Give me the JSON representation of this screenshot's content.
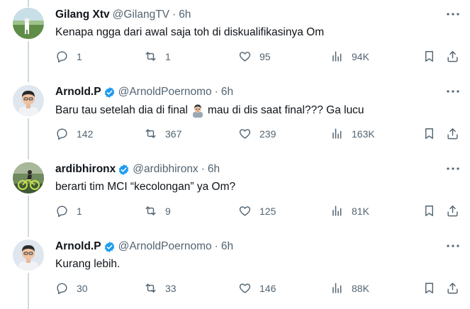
{
  "tweets": [
    {
      "name": "Gilang Xtv",
      "handle": "@GilangTV",
      "time": "6h",
      "verified": false,
      "text": "Kenapa ngga dari awal saja toh di diskualifikasinya Om",
      "text_after": "",
      "emoji": "",
      "replies": "1",
      "retweets": "1",
      "likes": "95",
      "views": "94K"
    },
    {
      "name": "Arnold.P",
      "handle": "@ArnoldPoernomo",
      "time": "6h",
      "verified": true,
      "text": "Baru tau setelah dia di final",
      "text_after": "mau di dis saat final??? Ga lucu",
      "emoji": "man-gesturing-icon",
      "replies": "142",
      "retweets": "367",
      "likes": "239",
      "views": "163K"
    },
    {
      "name": "ardibhironx",
      "handle": "@ardibhironx",
      "time": "6h",
      "verified": true,
      "text": "berarti tim MCI “kecolongan” ya Om?",
      "text_after": "",
      "emoji": "",
      "replies": "1",
      "retweets": "9",
      "likes": "125",
      "views": "81K"
    },
    {
      "name": "Arnold.P",
      "handle": "@ArnoldPoernomo",
      "time": "6h",
      "verified": true,
      "text": "Kurang lebih.",
      "text_after": "",
      "emoji": "",
      "replies": "30",
      "retweets": "33",
      "likes": "146",
      "views": "88K"
    }
  ],
  "separator": "·",
  "colors": {
    "verified": "#1d9bf0",
    "muted": "#536471",
    "thread_line": "#cfd9de"
  }
}
